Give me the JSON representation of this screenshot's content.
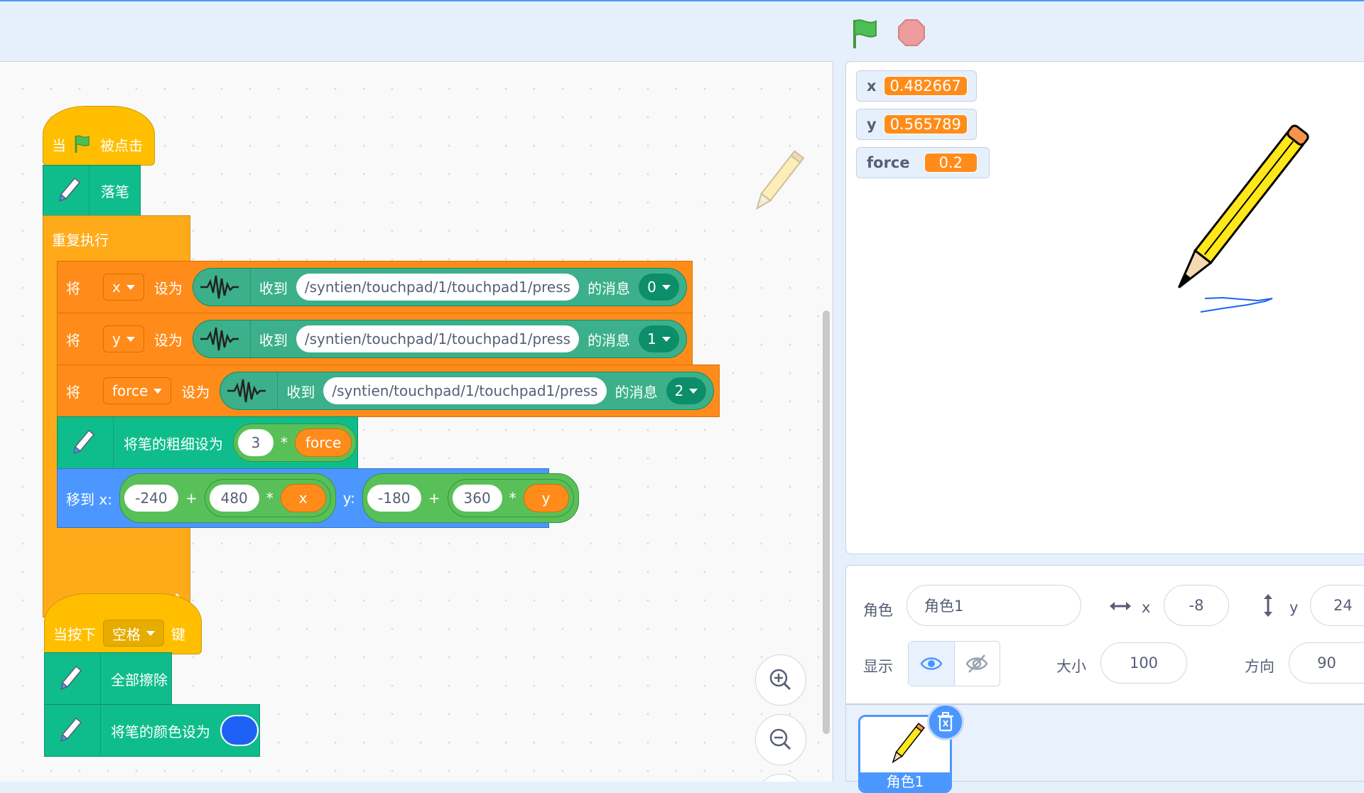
{
  "toolbar": {
    "green_flag": "green-flag-icon",
    "stop": "stop-icon"
  },
  "script1": {
    "hat_when": "当",
    "hat_clicked": "被点击",
    "pen_down": "落笔",
    "forever": "重复执行",
    "set_rows": [
      {
        "set": "将",
        "var": "x",
        "to": "设为",
        "receive": "收到",
        "address": "/syntien/touchpad/1/touchpad1/press",
        "msg": "的消息",
        "index": "0"
      },
      {
        "set": "将",
        "var": "y",
        "to": "设为",
        "receive": "收到",
        "address": "/syntien/touchpad/1/touchpad1/press",
        "msg": "的消息",
        "index": "1"
      },
      {
        "set": "将",
        "var": "force",
        "to": "设为",
        "receive": "收到",
        "address": "/syntien/touchpad/1/touchpad1/press",
        "msg": "的消息",
        "index": "2"
      }
    ],
    "pen_size": {
      "label": "将笔的粗细设为",
      "factor": "3",
      "op": "*",
      "var": "force"
    },
    "goto": {
      "label_x": "移到 x:",
      "x_offset": "-240",
      "plus1": "+",
      "x_scale": "480",
      "mul1": "*",
      "x_var": "x",
      "label_y": "y:",
      "y_offset": "-180",
      "plus2": "+",
      "y_scale": "360",
      "mul2": "*",
      "y_var": "y"
    }
  },
  "script2": {
    "hat_label": "当按下",
    "key": "空格",
    "hat_suffix": "键",
    "clear": "全部擦除",
    "pen_color": "将笔的颜色设为",
    "pen_color_value": "#1d62f5"
  },
  "stage": {
    "monitors": [
      {
        "name": "x",
        "value": "0.482667"
      },
      {
        "name": "y",
        "value": "0.565789"
      },
      {
        "name": "force",
        "value": "0.2"
      }
    ]
  },
  "sprite_info": {
    "sprite_label": "角色",
    "sprite_name": "角色1",
    "x_label": "x",
    "x_value": "-8",
    "y_label": "y",
    "y_value": "24",
    "show_label": "显示",
    "size_label": "大小",
    "size_value": "100",
    "direction_label": "方向",
    "direction_value": "90"
  },
  "sprite_list": {
    "items": [
      {
        "name": "角色1"
      }
    ]
  }
}
